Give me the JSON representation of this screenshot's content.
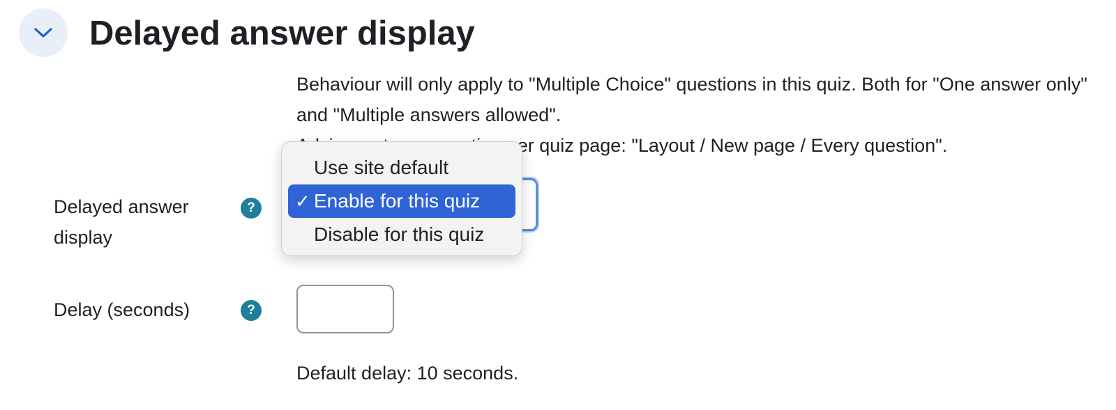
{
  "section": {
    "title": "Delayed answer display",
    "toggle_icon": "chevron-down-icon",
    "description_line1": "Behaviour will only apply to \"Multiple Choice\" questions in this quiz. Both for \"One answer only\" and \"Multiple answers allowed\".",
    "description_line2": "Advice: set one question per quiz page: \"Layout / New page / Every question\"."
  },
  "fields": {
    "delayed_display": {
      "label": "Delayed answer display",
      "help_icon": "?",
      "selected": "Enable for this quiz",
      "options": [
        {
          "label": "Use site default"
        },
        {
          "label": "Enable for this quiz",
          "check": "✓"
        },
        {
          "label": "Disable for this quiz"
        }
      ]
    },
    "delay_seconds": {
      "label": "Delay (seconds)",
      "help_icon": "?",
      "value": "",
      "note": "Default delay: 10 seconds."
    }
  },
  "colors": {
    "accent": "#2f63d6",
    "help_icon": "#1f7e9a",
    "toggle_bg": "#e8eff8"
  }
}
